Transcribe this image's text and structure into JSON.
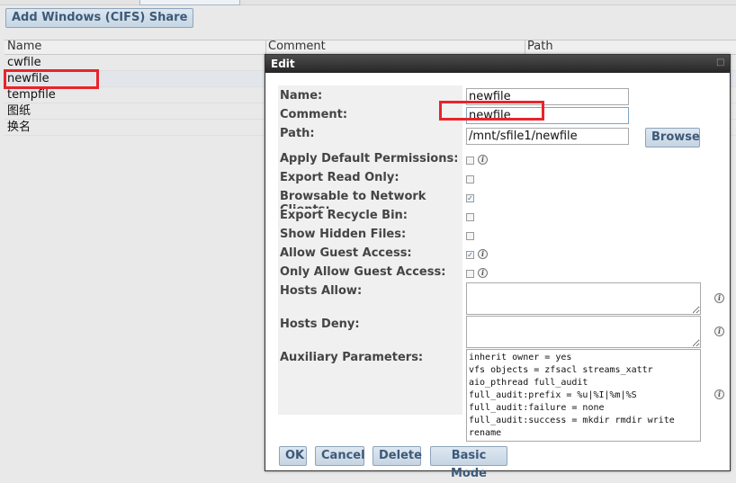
{
  "toolbar": {
    "add_label": "Add Windows (CIFS) Share"
  },
  "list": {
    "headers": [
      "Name",
      "Comment",
      "Path"
    ],
    "rows": [
      "cwfile",
      "newfile",
      "tempfile",
      "图纸",
      "换名"
    ]
  },
  "dialog": {
    "title": "Edit",
    "fields": {
      "name_label": "Name:",
      "name_value": "newfile",
      "comment_label": "Comment:",
      "comment_value": "newfile",
      "path_label": "Path:",
      "path_value": "/mnt/sfile1/newfile",
      "browse_label": "Browse",
      "apply_default_label": "Apply Default Permissions:",
      "export_read_only_label": "Export Read Only:",
      "browsable_label": "Browsable to Network Clients:",
      "recycle_label": "Export Recycle Bin:",
      "hidden_label": "Show Hidden Files:",
      "guest_label": "Allow Guest Access:",
      "only_guest_label": "Only Allow Guest Access:",
      "hosts_allow_label": "Hosts Allow:",
      "hosts_deny_label": "Hosts Deny:",
      "aux_label": "Auxiliary Parameters:",
      "aux_value": "inherit owner = yes\nvfs objects = zfsacl streams_xattr\naio_pthread full_audit\nfull_audit:prefix = %u|%I|%m|%S\nfull_audit:failure = none\nfull_audit:success = mkdir rmdir write\nrename"
    },
    "checks": {
      "apply_default": false,
      "export_read_only": false,
      "browsable": true,
      "recycle": false,
      "hidden": false,
      "guest": true,
      "only_guest": false
    },
    "buttons": {
      "ok": "OK",
      "cancel": "Cancel",
      "delete": "Delete",
      "basic": "Basic Mode"
    }
  },
  "icons": {
    "info": "info-icon",
    "check": "checkmark-icon",
    "close": "close-icon"
  },
  "colors": {
    "highlight": "#e8242a",
    "title_bar": "#333333",
    "button_text": "#3d5a78"
  }
}
